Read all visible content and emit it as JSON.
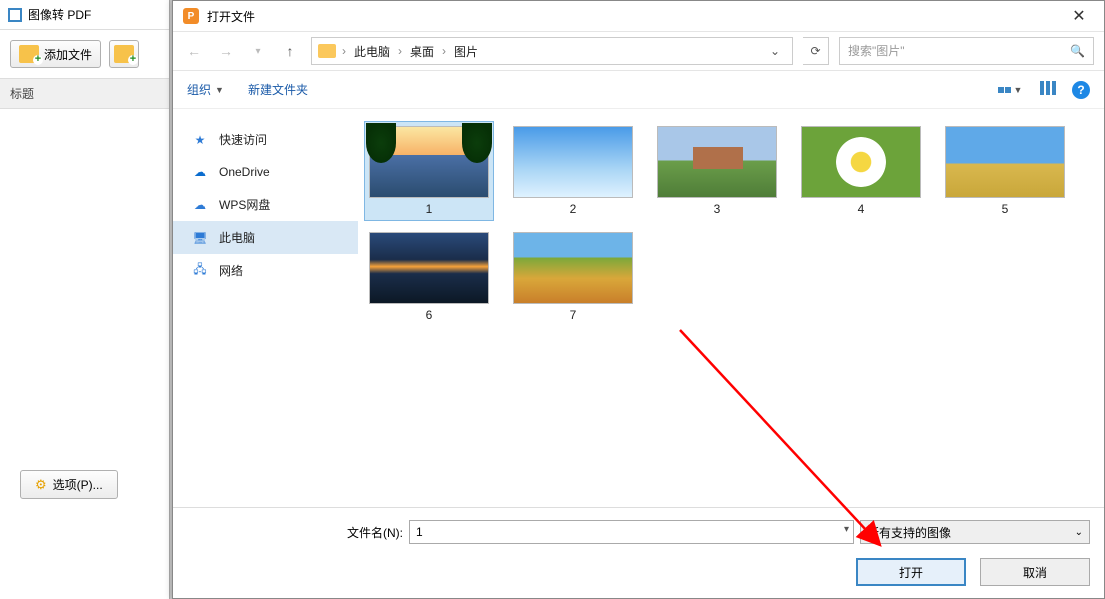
{
  "parent": {
    "title": "图像转 PDF",
    "add_file": "添加文件",
    "column_title": "标题",
    "options": "选项(P)..."
  },
  "dialog": {
    "title": "打开文件",
    "breadcrumbs": [
      "此电脑",
      "桌面",
      "图片"
    ],
    "search_placeholder": "搜索\"图片\"",
    "organize": "组织",
    "new_folder": "新建文件夹",
    "sidebar": {
      "quick": "快速访问",
      "onedrive": "OneDrive",
      "wps": "WPS网盘",
      "thispc": "此电脑",
      "network": "网络"
    },
    "files": [
      {
        "label": "1",
        "cls": "th1",
        "selected": true
      },
      {
        "label": "2",
        "cls": "th2",
        "selected": false
      },
      {
        "label": "3",
        "cls": "th3",
        "selected": false
      },
      {
        "label": "4",
        "cls": "th4",
        "selected": false
      },
      {
        "label": "5",
        "cls": "th5",
        "selected": false
      },
      {
        "label": "6",
        "cls": "th6",
        "selected": false
      },
      {
        "label": "7",
        "cls": "th7",
        "selected": false
      }
    ],
    "filename_label": "文件名(N):",
    "filename_value": "1",
    "filter": "所有支持的图像",
    "open": "打开",
    "cancel": "取消"
  }
}
